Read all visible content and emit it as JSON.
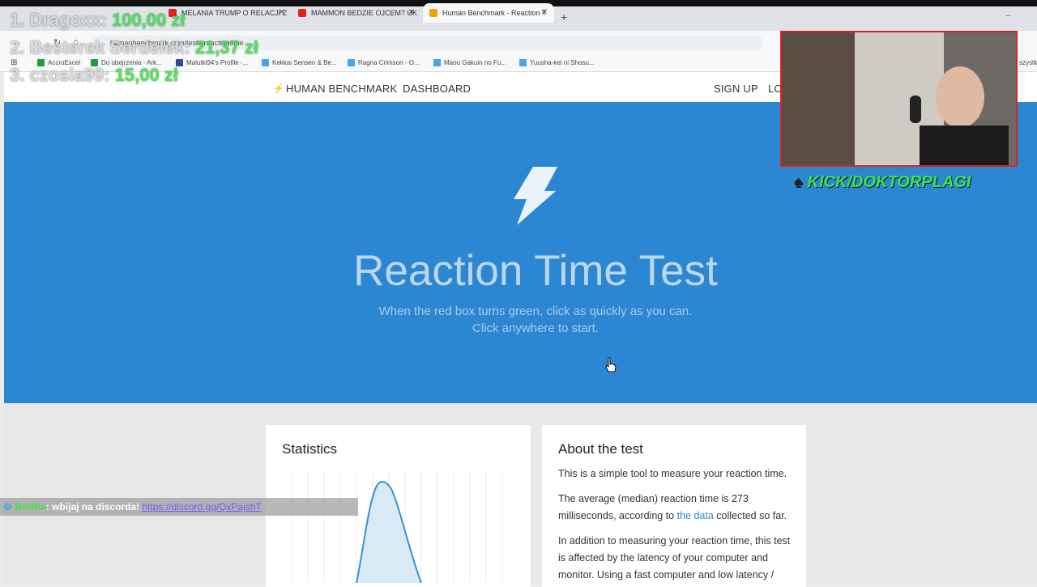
{
  "browser": {
    "tabs": [
      {
        "label": "MELANIA TRUMP O RELACJI Z",
        "favicon_color": "#e62117"
      },
      {
        "label": "MAMMON BEDZIE OJCEM? UK",
        "favicon_color": "#e62117"
      },
      {
        "label": "Human Benchmark - Reaction T",
        "favicon_color": "#f0a30a",
        "active": true
      }
    ],
    "new_tab_icon": "+",
    "minimize_icon": "–",
    "url": "humanbenchmark.com/tests/reactiontime",
    "bookmarks": [
      {
        "label": "AccroExcel",
        "icon_color": "#1e9e3a"
      },
      {
        "label": "Do obejrzenia - Ark...",
        "icon_color": "#1e9e3a"
      },
      {
        "label": "Malutki94's Profile -...",
        "icon_color": "#2d4e9a"
      },
      {
        "label": "Kekkai Sensen & Be...",
        "icon_color": "#4aa3e6"
      },
      {
        "label": "Ragna Crimson - O...",
        "icon_color": "#4aa3e6"
      },
      {
        "label": "Maou Gakuin no Fu...",
        "icon_color": "#4aa3e6"
      },
      {
        "label": "Yuusha-kei ni Shosu...",
        "icon_color": "#4aa3e6"
      }
    ],
    "bookmark_overflow": "szystk"
  },
  "site": {
    "nav": {
      "brand": "HUMAN BENCHMARK",
      "dashboard": "DASHBOARD",
      "signup": "SIGN UP",
      "login": "LO"
    },
    "hero": {
      "title": "Reaction Time Test",
      "subtitle1": "When the red box turns green, click as quickly as you can.",
      "subtitle2": "Click anywhere to start.",
      "color": "#2b87d1"
    },
    "stats": {
      "title": "Statistics"
    },
    "about": {
      "title": "About the test",
      "p1": "This is a simple tool to measure your reaction time.",
      "p2a": "The average (median) reaction time is 273",
      "p2b": "milliseconds, according to",
      "p2_link": "the data",
      "p2c": "collected so far.",
      "p3a": "In addition to measuring your reaction time, this test",
      "p3b": "is affected by the latency of your computer and",
      "p3c": "monitor. Using a fast computer and low latency /"
    }
  },
  "overlay": {
    "donors": [
      {
        "name": "1. Dragoxx:",
        "amount": "100,00 zł"
      },
      {
        "name": "2. Besterek Serdelek:",
        "amount": "21,37 zł"
      },
      {
        "name": "3. czosia99:",
        "amount": "15,00 zł"
      }
    ],
    "kick": "KICK/DOKTORPLAGI",
    "chat": {
      "user": "BotRix",
      "message": ": wbijaj na discorda!",
      "url": "https://discord.gg/QxPajshT"
    }
  }
}
